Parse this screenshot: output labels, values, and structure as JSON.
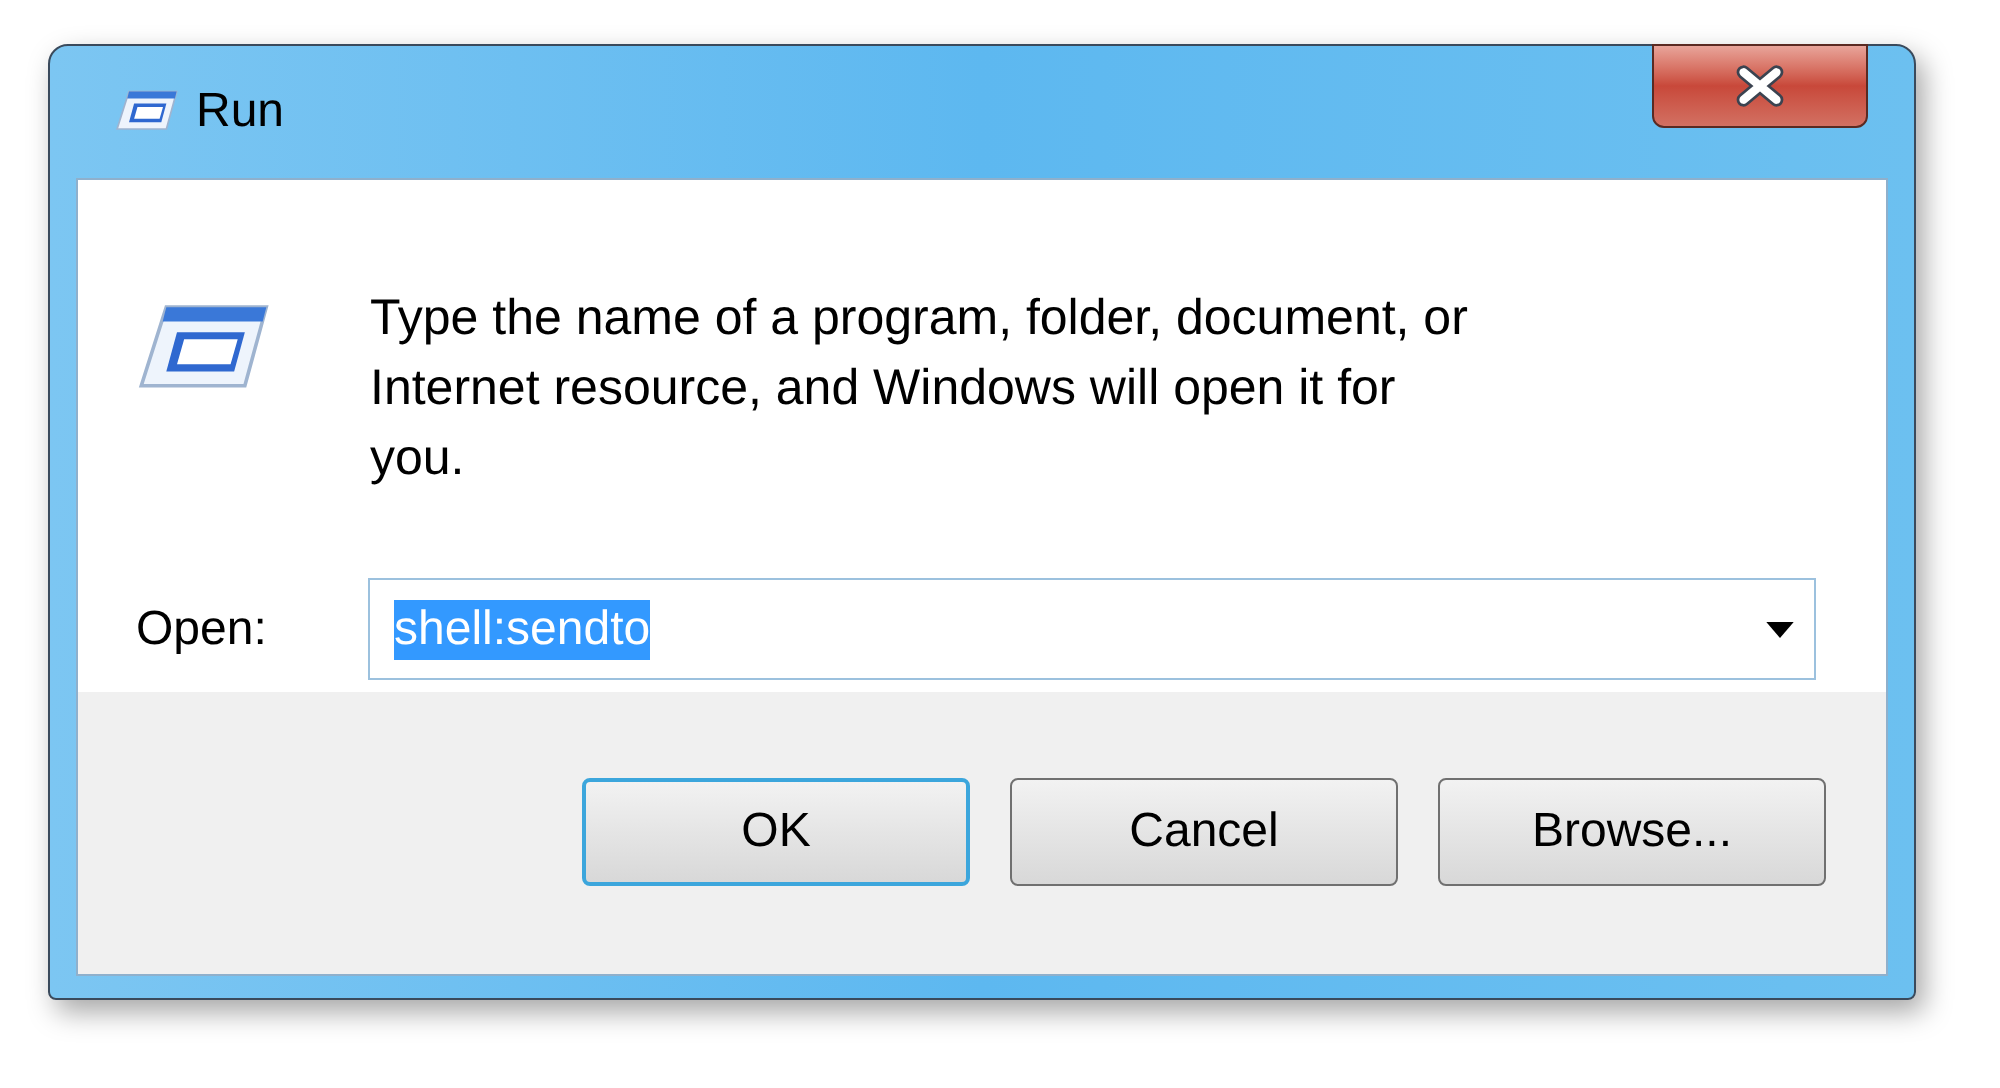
{
  "window": {
    "title": "Run"
  },
  "message": "Type the name of a program, folder, document, or Internet resource, and Windows will open it for you.",
  "open_field": {
    "label": "Open:",
    "value": "shell:sendto",
    "value_selected": true
  },
  "buttons": [
    {
      "label": "OK",
      "default": true
    },
    {
      "label": "Cancel",
      "default": false
    },
    {
      "label": "Browse...",
      "default": false
    }
  ]
}
